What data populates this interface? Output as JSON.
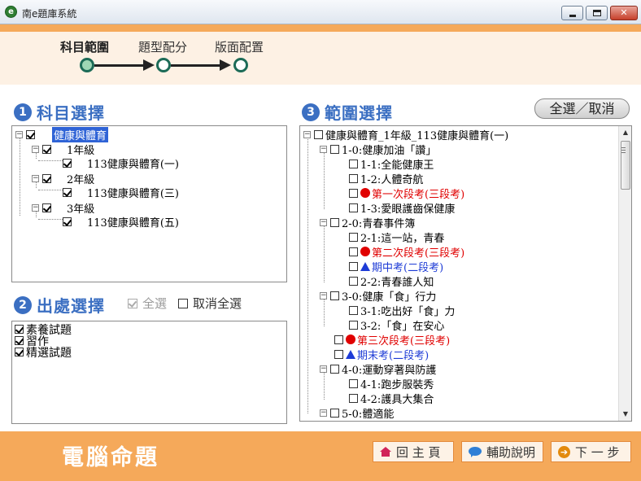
{
  "window": {
    "title": "南e題庫系統",
    "icon_name": "app-logo-icon"
  },
  "stepper": {
    "steps": [
      {
        "label": "科目範圍",
        "active": true
      },
      {
        "label": "題型配分",
        "active": false
      },
      {
        "label": "版面配置",
        "active": false
      }
    ]
  },
  "subject_section": {
    "number": "1",
    "title": "科目選擇",
    "tree": [
      {
        "label": "健康與體育",
        "checked": true,
        "selected": true
      },
      {
        "label": "1年級",
        "checked": true
      },
      {
        "label": "113健康與體育(一)",
        "checked": true
      },
      {
        "label": "2年級",
        "checked": true
      },
      {
        "label": "113健康與體育(三)",
        "checked": true
      },
      {
        "label": "3年級",
        "checked": true
      },
      {
        "label": "113健康與體育(五)",
        "checked": true
      }
    ]
  },
  "source_section": {
    "number": "2",
    "title": "出處選擇",
    "select_all_label": "全選",
    "select_all_checked": true,
    "deselect_all_label": "取消全選",
    "deselect_all_checked": false,
    "items": [
      {
        "label": "素養試題",
        "checked": true
      },
      {
        "label": "習作",
        "checked": true
      },
      {
        "label": "精選試題",
        "checked": true
      }
    ]
  },
  "range_section": {
    "number": "3",
    "title": "範圍選擇",
    "toggle_all_label": "全選／取消",
    "tree": [
      {
        "label": "健康與體育_1年級_113健康與體育(一)",
        "style": "normal"
      },
      {
        "label": "1-0:健康加油「讚」",
        "style": "normal"
      },
      {
        "label": "1-1:全能健康王",
        "style": "normal"
      },
      {
        "label": "1-2:人體奇航",
        "style": "normal"
      },
      {
        "label": "第一次段考(三段考)",
        "style": "red"
      },
      {
        "label": "1-3:愛眼護齒保健康",
        "style": "normal"
      },
      {
        "label": "2-0:青春事件簿",
        "style": "normal"
      },
      {
        "label": "2-1:這一站，青春",
        "style": "normal"
      },
      {
        "label": "第二次段考(三段考)",
        "style": "red"
      },
      {
        "label": "期中考(二段考)",
        "style": "blue"
      },
      {
        "label": "2-2:青春誰人知",
        "style": "normal"
      },
      {
        "label": "3-0:健康「食」行力",
        "style": "normal"
      },
      {
        "label": "3-1:吃出好「食」力",
        "style": "normal"
      },
      {
        "label": "3-2:「食」在安心",
        "style": "normal"
      },
      {
        "label": "第三次段考(三段考)",
        "style": "red"
      },
      {
        "label": "期末考(二段考)",
        "style": "blue"
      },
      {
        "label": "4-0:運動穿著與防護",
        "style": "normal"
      },
      {
        "label": "4-1:跑步服裝秀",
        "style": "normal"
      },
      {
        "label": "4-2:護具大集合",
        "style": "normal"
      },
      {
        "label": "5-0:體適能",
        "style": "normal"
      }
    ],
    "colors": {
      "red": "#e00000",
      "blue": "#1d3bd6"
    }
  },
  "footer": {
    "title": "電腦命題",
    "home_label": "回 主 頁",
    "help_label": "輔助說明",
    "next_label": "下 一 步"
  },
  "colors": {
    "accent_orange": "#f5a95a",
    "section_blue": "#3b6fc2",
    "step_green": "#1c6b57"
  }
}
